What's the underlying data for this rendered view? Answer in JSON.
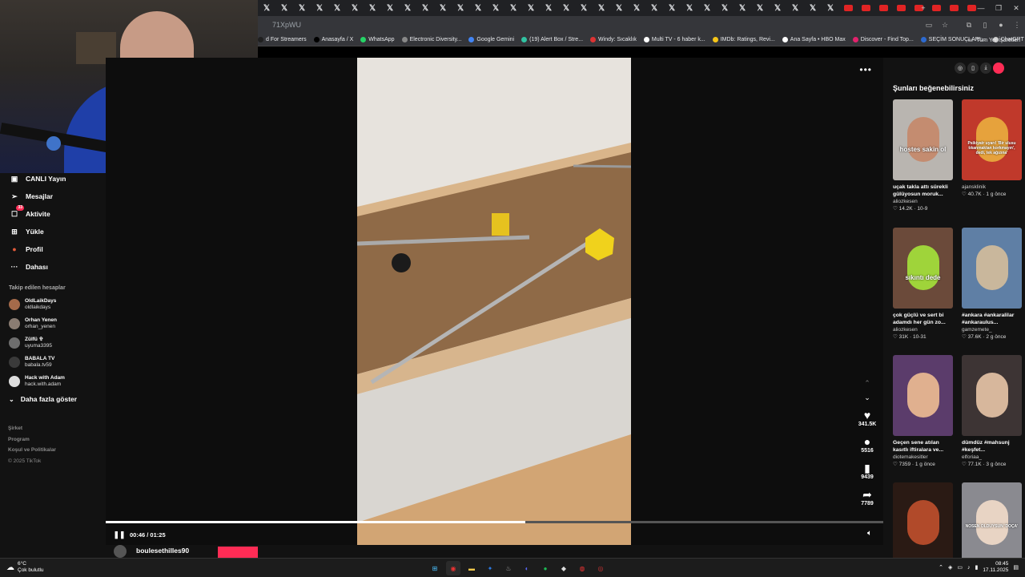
{
  "browser": {
    "url_fragment": "71XpWU",
    "bookmarks": [
      {
        "label": "d For Streamers",
        "color": "#1f1f1f"
      },
      {
        "label": "Anasayfa / X",
        "color": "#000"
      },
      {
        "label": "WhatsApp",
        "color": "#25d366"
      },
      {
        "label": "Electronic Diversity...",
        "color": "#888"
      },
      {
        "label": "Google Gemini",
        "color": "#4285f4"
      },
      {
        "label": "(19) Alert Box / Stre...",
        "color": "#31c3a2"
      },
      {
        "label": "Windy: Sıcaklık",
        "color": "#d33"
      },
      {
        "label": "Multi TV - 6 haber k...",
        "color": "#fff"
      },
      {
        "label": "IMDb: Ratings, Revi...",
        "color": "#f5c518"
      },
      {
        "label": "Ana Sayfa • HBO Max",
        "color": "#fff"
      },
      {
        "label": "Discover - Find Top...",
        "color": "#e2226c"
      },
      {
        "label": "SEÇİM SONUÇLARI...",
        "color": "#2d6ad0"
      },
      {
        "label": "ChatGPT",
        "color": "#ccc"
      }
    ],
    "bookmarks_right": "Tüm Yer İşaretleri"
  },
  "sidebar": {
    "nav": [
      {
        "label": "CANLI Yayın",
        "icon": "live-icon",
        "glyph": "▣",
        "badge": ""
      },
      {
        "label": "Mesajlar",
        "icon": "message-icon",
        "glyph": "➢",
        "badge": ""
      },
      {
        "label": "Aktivite",
        "icon": "activity-icon",
        "glyph": "☐",
        "badge": "33"
      },
      {
        "label": "Yükle",
        "icon": "upload-icon",
        "glyph": "⊞",
        "badge": ""
      },
      {
        "label": "Profil",
        "icon": "profile-icon",
        "glyph": "●",
        "badge": ""
      },
      {
        "label": "Dahası",
        "icon": "more-icon",
        "glyph": "···",
        "badge": ""
      }
    ],
    "following_title": "Takip edilen hesaplar",
    "following": [
      {
        "name": "OldLaikDays",
        "handle": "oldlaikdays",
        "color": "#a56a4a"
      },
      {
        "name": "Orhan Yenen",
        "handle": "orhan_yenen",
        "color": "#8a7c72"
      },
      {
        "name": "Zülfü ✞",
        "handle": "uyuma3395",
        "color": "#6e6e6e"
      },
      {
        "name": "BABALA TV",
        "handle": "babala.tv59",
        "color": "#3a3a3a"
      },
      {
        "name": "Hack with Adam",
        "handle": "hack.with.adam",
        "color": "#dddddd"
      }
    ],
    "show_more": "Daha fazla göster",
    "footer": [
      "Şirket",
      "Program",
      "Koşul ve Politikalar"
    ],
    "copyright": "© 2025 TikTok"
  },
  "player": {
    "time": "00:46 / 01:25",
    "progress": 0.54,
    "likes": "341.5K",
    "comments": "5516",
    "saves": "9439",
    "shares": "7789",
    "author": "boulesethilles90"
  },
  "rail": {
    "title": "Şunları beğenebilirsiniz",
    "cards": [
      {
        "title": "uçak takla attı sürekli gülüyosun moruk...",
        "author": "aliozkesen",
        "stats": "♡ 14.2K · 10-9",
        "overlay": "hostes sakin ol",
        "bg": "#b9b5b0",
        "face": "#c48c70"
      },
      {
        "title": "",
        "author": "ajansklinik",
        "stats": "♡ 40.7K · 1 g önce",
        "overlay": "Psikiyatr uyarı! 'Bir ulusu tıkanmaktan korkmayın', dedi, tek ağızına'",
        "bg": "#c0392b",
        "face": "#e6a23c"
      },
      {
        "title": "çok güçlü ve sert bi adamdı her gün zo...",
        "author": "aliozkesen",
        "stats": "♡ 31K · 10-31",
        "overlay": "sıkıntı dede",
        "bg": "#6b4a3a",
        "face": "#9fd43a"
      },
      {
        "title": "#ankara #ankaralilar #ankaraulus...",
        "author": "gamzemete_",
        "stats": "♡ 37.6K · 2 g önce",
        "overlay": "",
        "bg": "#5f7fa5",
        "face": "#c9b79c"
      },
      {
        "title": "Geçen sene atılan kasıtlı iftiralara ve...",
        "author": "diotemakesitler",
        "stats": "♡ 7359 · 1 g önce",
        "overlay": "",
        "bg": "#5b3c6b",
        "face": "#e0b08f"
      },
      {
        "title": "dümdüz #mahsunj #keşfet...",
        "author": "elforiaa_",
        "stats": "♡ 77.1K · 3 g önce",
        "overlay": "",
        "bg": "#3d3434",
        "face": "#d7b79c"
      },
      {
        "title": "",
        "author": "",
        "stats": "",
        "overlay": "",
        "bg": "#2a1a14",
        "face": "#b14a2a"
      },
      {
        "title": "",
        "author": "",
        "stats": "",
        "overlay": "NOSEN OLDUYSUN 'DOÇA'",
        "bg": "#8a8a90",
        "face": "#e8d4c4"
      }
    ]
  },
  "taskbar": {
    "temp": "6°C",
    "weather": "Çok bulutlu",
    "time": "08:45",
    "date": "17.11.2025"
  },
  "colors": {
    "accent": "#fe2c55",
    "bg": "#121212"
  }
}
